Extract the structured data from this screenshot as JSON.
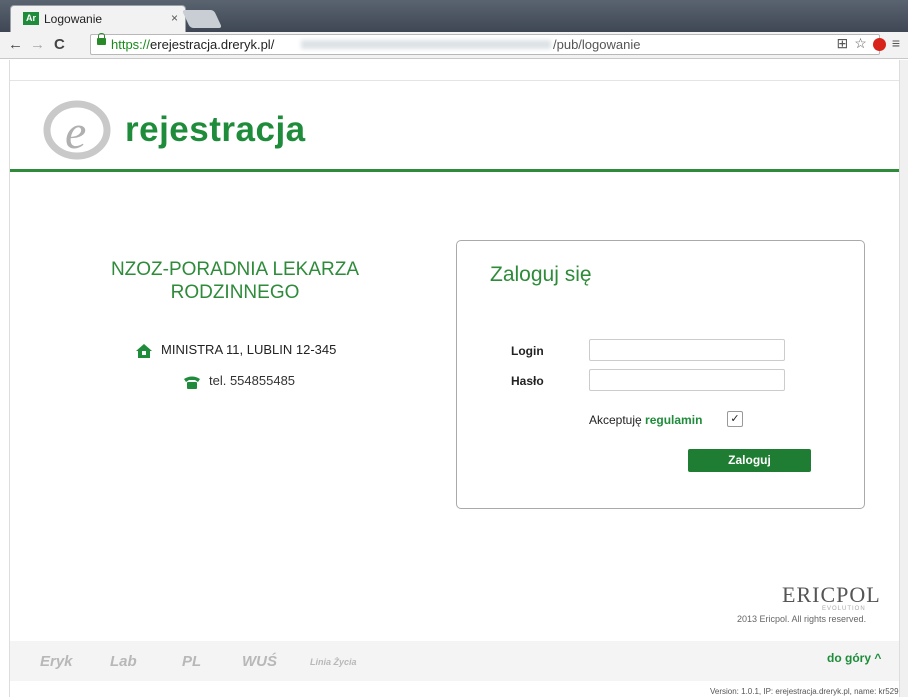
{
  "browser": {
    "tab_title": "Logowanie",
    "tab_close": "×",
    "url_prefix": "https://",
    "url_domain": "erejestracja.dreryk.pl/",
    "url_suffix": "/pub/logowanie"
  },
  "header": {
    "logo_text": "rejestracja"
  },
  "clinic": {
    "name": "NZOZ-PORADNIA LEKARZA RODZINNEGO",
    "address": "MINISTRA 11, LUBLIN 12-345",
    "phone": "tel. 554855485"
  },
  "login": {
    "title": "Zaloguj się",
    "login_label": "Login",
    "password_label": "Hasło",
    "login_value": "",
    "password_value": "",
    "accept_text": "Akceptuję",
    "accept_link": "regulamin",
    "accept_checked": true,
    "checkmark": "✓",
    "submit_label": "Zaloguj"
  },
  "brand": {
    "company": "ERICPOL",
    "tagline": "EVOLUTION",
    "copyright": "2013 Ericpol. All rights reserved."
  },
  "footer": {
    "products": [
      "Eryk",
      "Lab",
      "PL",
      "WUŚ",
      "Linia Życia"
    ],
    "back_to_top": "do góry ^",
    "version": "Version: 1.0.1, IP: erejestracja.dreryk.pl, name: kr529"
  },
  "colors": {
    "accent": "#2e8b3a",
    "button": "#1e7d32"
  }
}
